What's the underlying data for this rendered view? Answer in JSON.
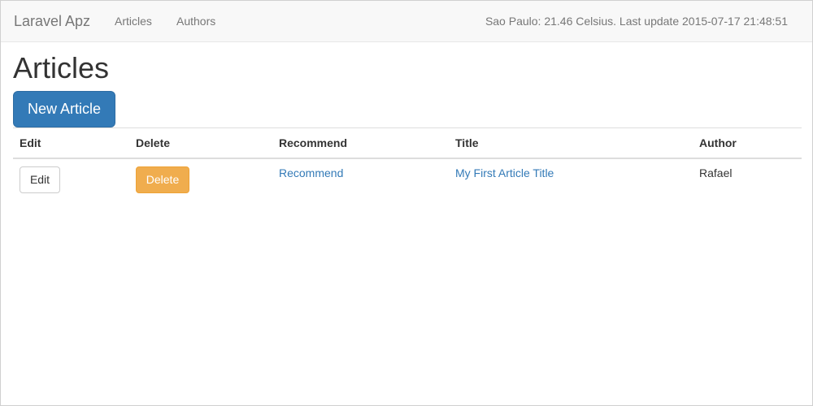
{
  "navbar": {
    "brand": "Laravel Apz",
    "links": [
      {
        "label": "Articles"
      },
      {
        "label": "Authors"
      }
    ],
    "weather": "Sao Paulo: 21.46 Celsius. Last update 2015-07-17 21:48:51"
  },
  "main": {
    "title": "Articles",
    "new_button": "New Article",
    "table": {
      "headers": [
        "Edit",
        "Delete",
        "Recommend",
        "Title",
        "Author"
      ],
      "rows": [
        {
          "edit": "Edit",
          "delete": "Delete",
          "recommend": "Recommend",
          "title": "My First Article Title",
          "author": "Rafael"
        }
      ]
    }
  },
  "colors": {
    "primary": "#337ab7",
    "warning": "#f0ad4e",
    "navbar_bg": "#f8f8f8",
    "nav_text": "#777777"
  }
}
